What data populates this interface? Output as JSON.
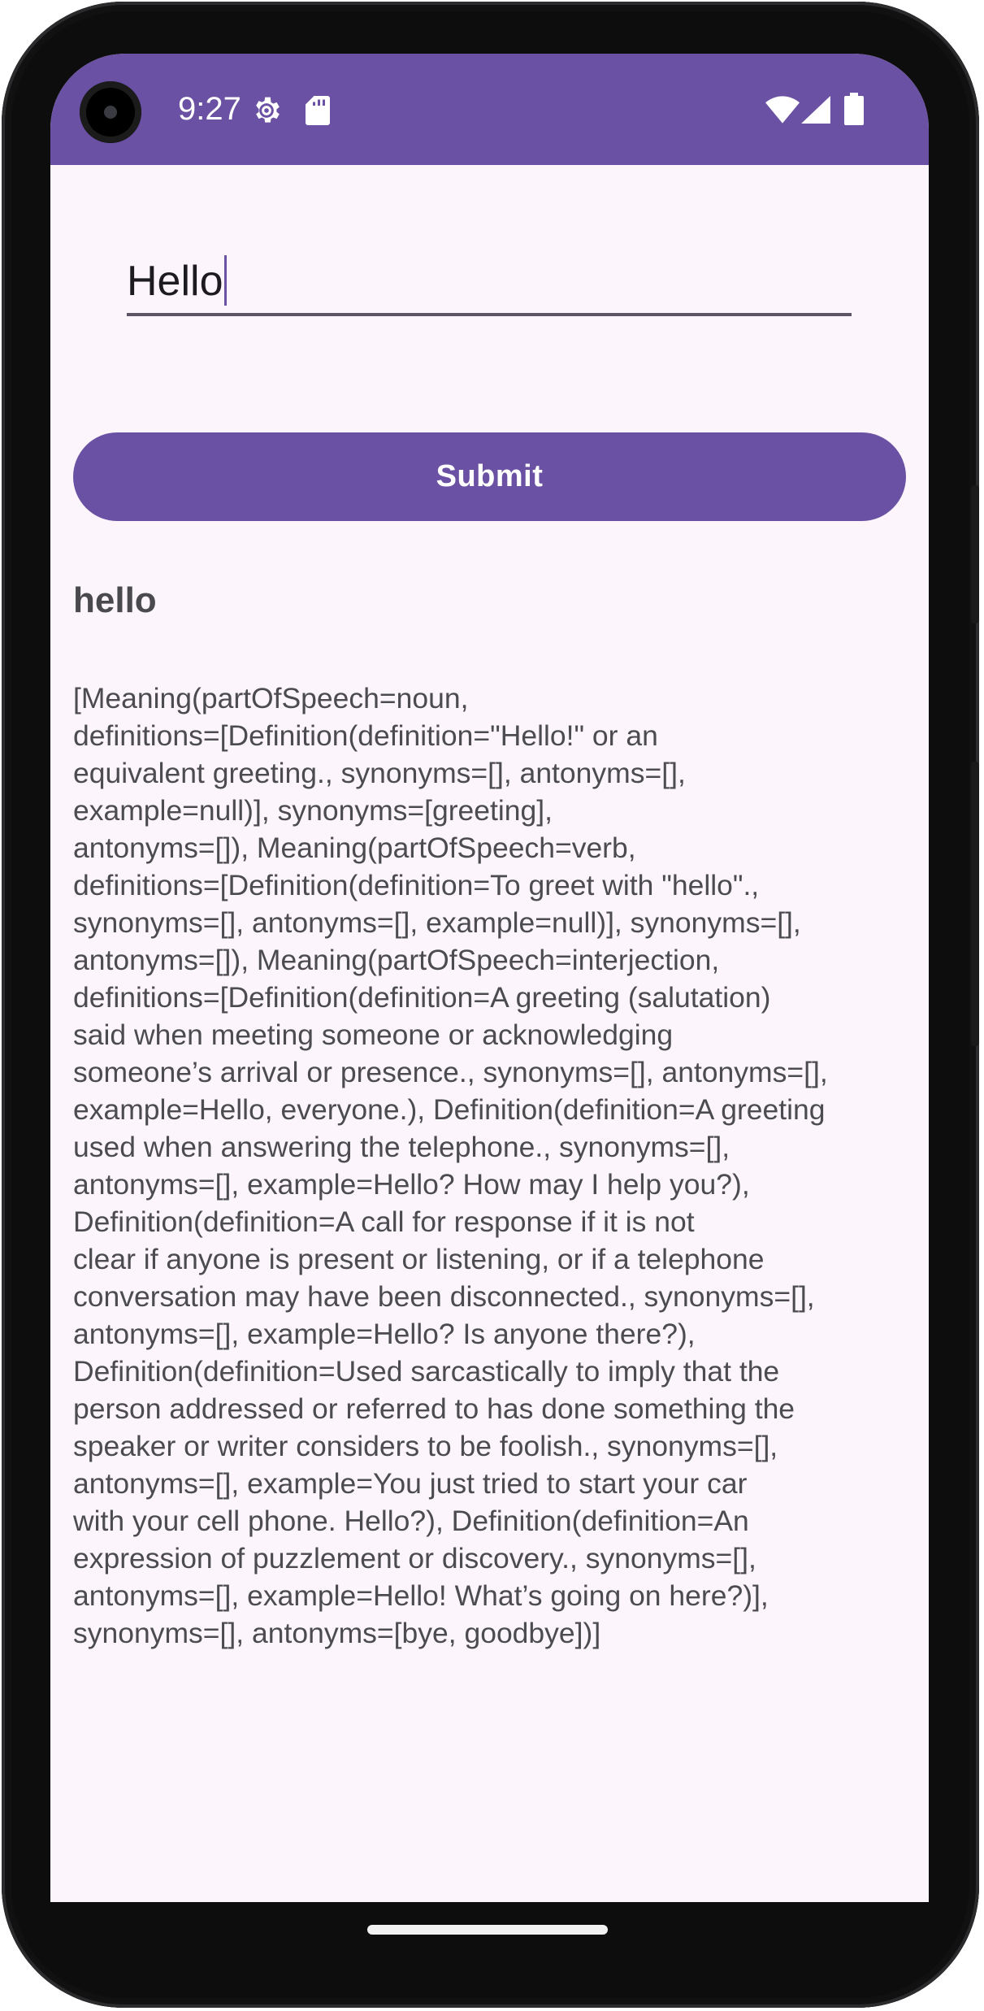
{
  "status_bar": {
    "time": "9:27",
    "icons": [
      "settings-icon",
      "sd-card-icon",
      "wifi-icon",
      "signal-icon",
      "battery-icon"
    ],
    "bg_color": "#6a51a3"
  },
  "search": {
    "value": "Hello",
    "cursor_visible": true
  },
  "actions": {
    "submit_label": "Submit",
    "accent_color": "#6a51a3"
  },
  "result": {
    "word": "hello",
    "lines": [
      "[Meaning(partOfSpeech=noun,",
      "definitions=[Definition(definition=\"Hello!\" or an",
      "equivalent greeting., synonyms=[], antonyms=[],",
      "example=null)], synonyms=[greeting],",
      "antonyms=[]), Meaning(partOfSpeech=verb,",
      "definitions=[Definition(definition=To greet with \"hello\".,",
      "synonyms=[], antonyms=[], example=null)], synonyms=[],",
      "antonyms=[]), Meaning(partOfSpeech=interjection,",
      "definitions=[Definition(definition=A greeting (salutation)",
      "said when meeting someone or acknowledging",
      "someone’s arrival or presence., synonyms=[], antonyms=[],",
      "example=Hello, everyone.), Definition(definition=A greeting",
      "used when answering the telephone., synonyms=[],",
      "antonyms=[], example=Hello? How may I help you?),",
      "Definition(definition=A call for response if it is not",
      "clear if anyone is present or listening, or if a telephone",
      "conversation may have been disconnected., synonyms=[],",
      "antonyms=[], example=Hello? Is anyone there?),",
      "Definition(definition=Used sarcastically to imply that the",
      "person addressed or referred to has done something the",
      "speaker or writer considers to be foolish., synonyms=[],",
      "antonyms=[], example=You just tried to start your car",
      "with your cell phone. Hello?), Definition(definition=An",
      "expression of puzzlement or discovery., synonyms=[],",
      "antonyms=[], example=Hello! What’s going on here?)],",
      "synonyms=[], antonyms=[bye, goodbye])]"
    ]
  }
}
